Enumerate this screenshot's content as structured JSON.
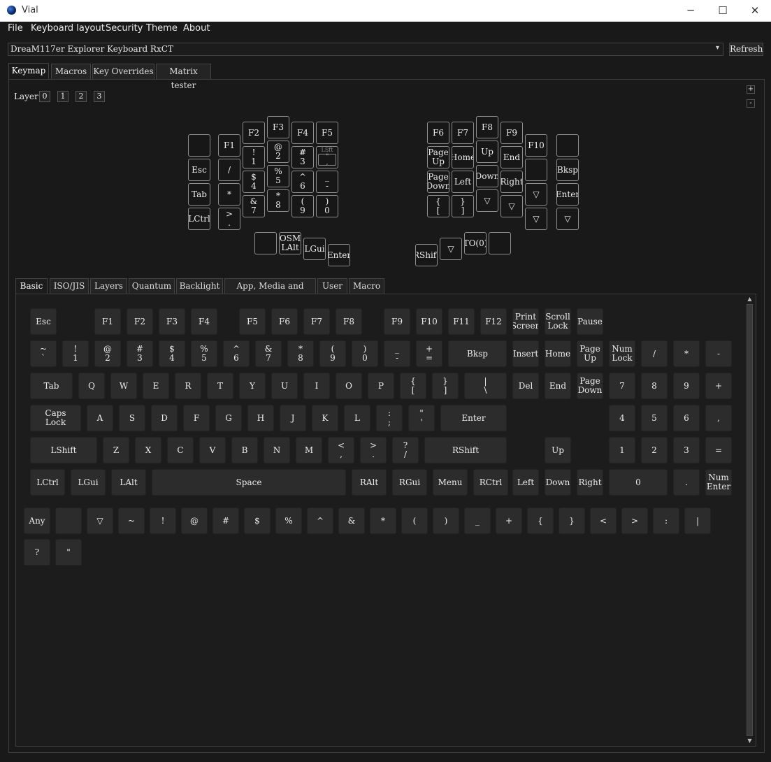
{
  "window": {
    "title": "Vial",
    "minimize": "─",
    "maximize": "☐",
    "close": "✕"
  },
  "menu": [
    "File",
    "Keyboard layout",
    "Security",
    "Theme",
    "About"
  ],
  "device": {
    "selected": "DreaM117er Explorer Keyboard RxCT",
    "dropdown_arrow": "▾",
    "refresh_label": "Refresh"
  },
  "main_tabs": [
    "Keymap",
    "Macros",
    "Key Overrides",
    "Matrix tester"
  ],
  "layer": {
    "label": "Layer",
    "buttons": [
      "0",
      "1",
      "2",
      "3"
    ],
    "plus": "+",
    "minus": "-"
  },
  "split_keys": [
    [
      "",
      "F1",
      "F2",
      "F3",
      "F4",
      "F5",
      "Esc",
      "/",
      "!\n1",
      "@\n2",
      "#\n3",
      "LSft\n\"\n,",
      "Tab",
      "*",
      "$\n4",
      "%\n5",
      "^\n6",
      "_\n-"
    ],
    [
      "LCtrl",
      ">\n.",
      "&\n7",
      "*\n8",
      "(\n9",
      ")\n0",
      "",
      "OSM\nLAlt",
      "LGui",
      "Enter"
    ],
    [
      "F6",
      "F7",
      "F8",
      "F9",
      "F10",
      "",
      "Page\nUp",
      "Home",
      "Up",
      "End",
      "",
      "Bksp",
      "Page\nDown",
      "Left",
      "Down",
      "Right",
      "▽",
      "Enter"
    ],
    [
      "{\n[",
      "}\n]",
      "▽",
      "▽",
      "▽",
      "▽",
      "RShift",
      "▽",
      "TO(0)",
      ""
    ]
  ],
  "bottom_tabs": [
    "Basic",
    "ISO/JIS",
    "Layers",
    "Quantum",
    "Backlight",
    "App, Media and Mouse",
    "User",
    "Macro"
  ],
  "basic_rows": [
    [
      "Esc",
      "F1",
      "F2",
      "F3",
      "F4",
      "F5",
      "F6",
      "F7",
      "F8",
      "F9",
      "F10",
      "F11",
      "F12",
      "Print\nScreen",
      "Scroll\nLock",
      "Pause"
    ],
    [
      "~\n`",
      "!\n1",
      "@\n2",
      "#\n3",
      "$\n4",
      "%\n5",
      "^\n6",
      "&\n7",
      "*\n8",
      "(\n9",
      ")\n0",
      "_\n-",
      "+\n=",
      "Bksp",
      "Insert",
      "Home",
      "Page\nUp",
      "Num\nLock",
      "/",
      "*",
      "-"
    ],
    [
      "Tab",
      "Q",
      "W",
      "E",
      "R",
      "T",
      "Y",
      "U",
      "I",
      "O",
      "P",
      "{\n[",
      "}\n]",
      "|\n\\",
      "Del",
      "End",
      "Page\nDown",
      "7",
      "8",
      "9",
      "+"
    ],
    [
      "Caps\nLock",
      "A",
      "S",
      "D",
      "F",
      "G",
      "H",
      "J",
      "K",
      "L",
      ":\n;",
      "\"\n'",
      "Enter",
      "4",
      "5",
      "6",
      ","
    ],
    [
      "LShift",
      "Z",
      "X",
      "C",
      "V",
      "B",
      "N",
      "M",
      "<\n,",
      ">\n.",
      "?\n/",
      "RShift",
      "Up",
      "1",
      "2",
      "3",
      "="
    ],
    [
      "LCtrl",
      "LGui",
      "LAlt",
      "Space",
      "RAlt",
      "RGui",
      "Menu",
      "RCtrl",
      "Left",
      "Down",
      "Right",
      "0",
      ".",
      "Num\nEnter"
    ]
  ],
  "extra_rows": [
    [
      "Any",
      "",
      "▽",
      "~",
      "!",
      "@",
      "#",
      "$",
      "%",
      "^",
      "&",
      "*",
      "(",
      ")",
      "_",
      "+",
      "{",
      "}",
      "<",
      ">",
      ":",
      "|"
    ],
    [
      "?",
      "\""
    ]
  ],
  "scroll": {
    "up": "▲",
    "down": "▼"
  }
}
